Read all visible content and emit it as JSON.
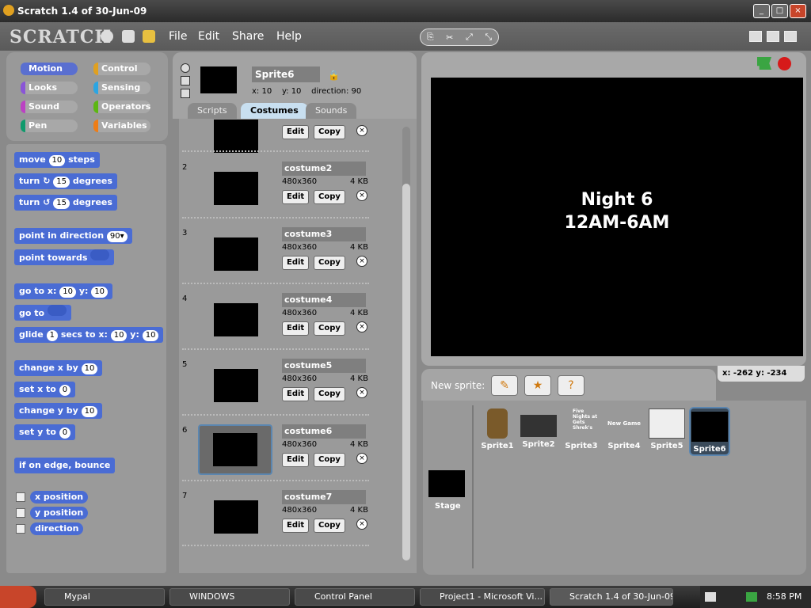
{
  "window": {
    "title": "Scratch 1.4 of 30-Jun-09",
    "buttons": [
      "_",
      "□",
      "×"
    ]
  },
  "app": {
    "logo": "SCRATCH",
    "menus": [
      "File",
      "Edit",
      "Share",
      "Help"
    ]
  },
  "categories": [
    {
      "label": "Motion",
      "color": "#5a6fd0",
      "selected": true
    },
    {
      "label": "Control",
      "color": "#e0a020"
    },
    {
      "label": "Looks",
      "color": "#8a55d7"
    },
    {
      "label": "Sensing",
      "color": "#2ca5e2"
    },
    {
      "label": "Sound",
      "color": "#bb42c3"
    },
    {
      "label": "Operators",
      "color": "#5cb712"
    },
    {
      "label": "Pen",
      "color": "#0e9a6c"
    },
    {
      "label": "Variables",
      "color": "#ee7d16"
    }
  ],
  "blocks": {
    "move": "move",
    "move_val": "10",
    "steps": "steps",
    "turn": "turn",
    "turn_val": "15",
    "degrees": "degrees",
    "turn2": "turn",
    "turn2_val": "15",
    "degrees2": "degrees",
    "pid": "point in direction",
    "pid_val": "90▾",
    "pt": "point towards",
    "goto": "go to x:",
    "goto_x": "10",
    "goto_y_lbl": "y:",
    "goto_y": "10",
    "goto2": "go to",
    "glide": "glide",
    "glide_s": "1",
    "glide_mid": "secs to x:",
    "glide_x": "10",
    "glide_y_lbl": "y:",
    "glide_y": "10",
    "cx": "change x by",
    "cx_val": "10",
    "sx": "set x to",
    "sx_val": "0",
    "cy": "change y by",
    "cy_val": "10",
    "sy": "set y to",
    "sy_val": "0",
    "bounce": "if on edge, bounce",
    "rep1": "x position",
    "rep2": "y position",
    "rep3": "direction"
  },
  "sprite": {
    "name": "Sprite6",
    "x_label": "x:",
    "x": "10",
    "y_label": "y:",
    "y": "10",
    "dir_label": "direction:",
    "dir": "90"
  },
  "tabs": [
    "Scripts",
    "Costumes",
    "Sounds"
  ],
  "costumes": [
    {
      "num": "2",
      "name": "costume2",
      "size": "480x360",
      "kb": "4 KB"
    },
    {
      "num": "3",
      "name": "costume3",
      "size": "480x360",
      "kb": "4 KB"
    },
    {
      "num": "4",
      "name": "costume4",
      "size": "480x360",
      "kb": "4 KB"
    },
    {
      "num": "5",
      "name": "costume5",
      "size": "480x360",
      "kb": "4 KB"
    },
    {
      "num": "6",
      "name": "costume6",
      "size": "480x360",
      "kb": "4 KB",
      "selected": true
    },
    {
      "num": "7",
      "name": "costume7",
      "size": "480x360",
      "kb": "4 KB"
    }
  ],
  "costume_buttons": {
    "edit": "Edit",
    "copy": "Copy",
    "delete": "×"
  },
  "stage": {
    "line1": "Night 6",
    "line2": "12AM-6AM",
    "mouse": "x: -262   y: -234"
  },
  "new_sprite": {
    "label": "New sprite:"
  },
  "corral": {
    "stage_label": "Stage",
    "sprites": [
      "Sprite1",
      "Sprite2",
      "Sprite3",
      "Sprite4",
      "Sprite5",
      "Sprite6"
    ],
    "thumb_text3": "Five Nights at Gets Shrek's",
    "thumb_text4": "New Game"
  },
  "taskbar": {
    "items": [
      "Mypal",
      "WINDOWS",
      "Control Panel",
      "Project1 - Microsoft Vi...",
      "Scratch 1.4 of 30-Jun-09"
    ],
    "clock": "8:58 PM"
  }
}
